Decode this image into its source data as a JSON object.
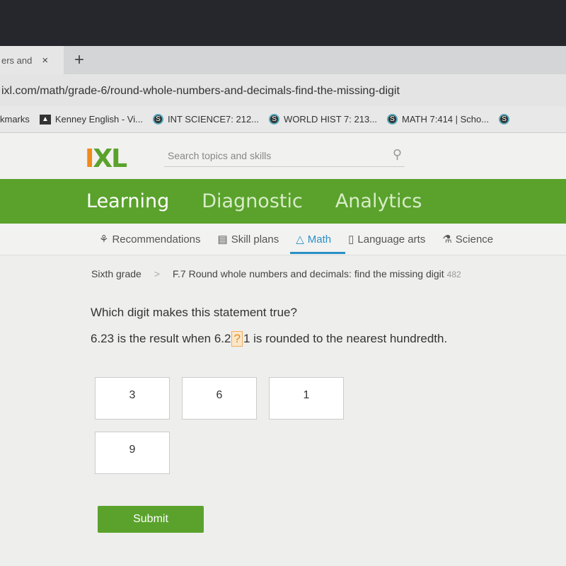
{
  "browser": {
    "tab_label": "ers and",
    "tab_close": "×",
    "new_tab": "+",
    "url": "ixl.com/math/grade-6/round-whole-numbers-and-decimals-find-the-missing-digit",
    "bookmarks": [
      {
        "label": "kmarks"
      },
      {
        "label": "Kenney English - Vi..."
      },
      {
        "label": "INT SCIENCE7: 212..."
      },
      {
        "label": "WORLD HIST 7: 213..."
      },
      {
        "label": "MATH 7:414 | Scho..."
      }
    ]
  },
  "header": {
    "logo": "IXL",
    "search_placeholder": "Search topics and skills"
  },
  "nav": {
    "items": [
      "Learning",
      "Diagnostic",
      "Analytics"
    ]
  },
  "subnav": {
    "items": [
      "Recommendations",
      "Skill plans",
      "Math",
      "Language arts",
      "Science"
    ]
  },
  "breadcrumb": {
    "grade": "Sixth grade",
    "separator": ">",
    "skill": "F.7 Round whole numbers and decimals: find the missing digit",
    "score": "482"
  },
  "question": {
    "prompt": "Which digit makes this statement true?",
    "before": "6.23 is the result when 6.2",
    "missing": "?",
    "after": "1 is rounded to the nearest hundredth."
  },
  "choices": [
    "3",
    "6",
    "1",
    "9"
  ],
  "submit_label": "Submit",
  "colors": {
    "brand_green": "#5aa22c",
    "accent_blue": "#2b90c8",
    "logo_orange": "#f08a1c"
  }
}
